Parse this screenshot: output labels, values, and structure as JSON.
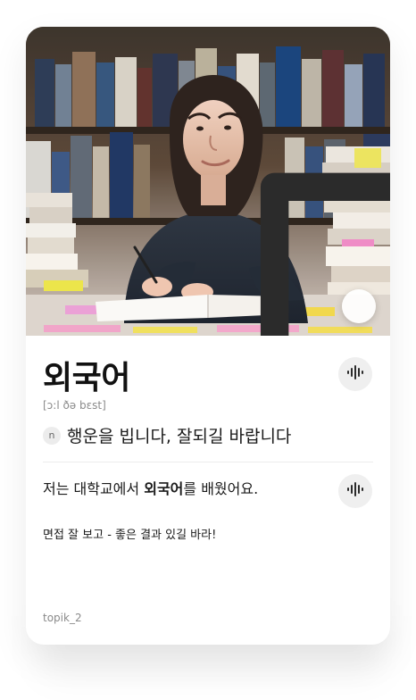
{
  "card": {
    "word": "외국어",
    "pronunciation": "[ɔ:l ðə bɛst]",
    "part_of_speech": "n",
    "meaning": "행운을 빕니다, 잘되길 바랍니다",
    "example": {
      "before": "저는 대학교에서 ",
      "highlight": "외국어",
      "after": "를 배웠어요."
    },
    "note": "면접 잘 보고 - 좋은 결과 있길 바라!",
    "tag": "topik_2"
  },
  "icons": {
    "bookmark": "bookmark-icon",
    "audio": "audio-wave-icon"
  },
  "colors": {
    "photo_base": "#4a3b2b",
    "icon_dark": "#2b2b2b",
    "muted_text": "#8a8a8a",
    "button_bg": "#efefef"
  }
}
